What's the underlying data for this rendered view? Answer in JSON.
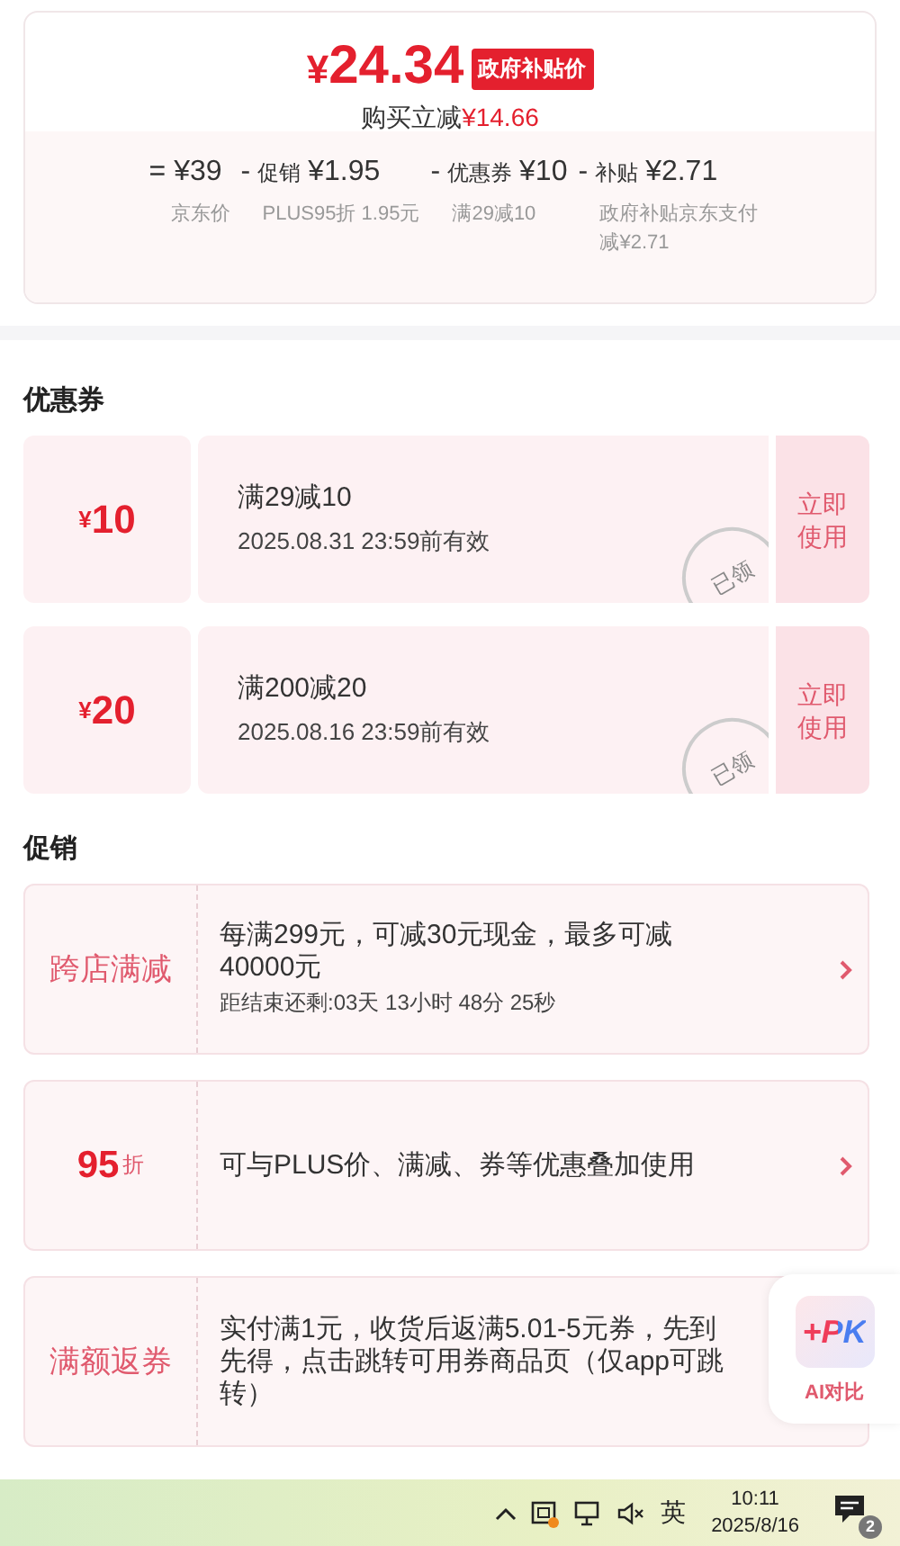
{
  "price": {
    "symbol": "¥",
    "amount": "24.34",
    "badge": "政府补贴价",
    "saving_label": "购买立减",
    "saving_amount": "¥14.66"
  },
  "breakdown": [
    {
      "operator": "=",
      "amount": "¥39",
      "note": "京东价"
    },
    {
      "operator": "-",
      "label": "促销",
      "amount": "¥1.95",
      "note": "PLUS95折 1.95元"
    },
    {
      "operator": "-",
      "label": "优惠券",
      "amount": "¥10",
      "note": "满29减10"
    },
    {
      "operator": "-",
      "label": "补贴",
      "amount": "¥2.71",
      "note": "政府补贴京东支付减¥2.71"
    }
  ],
  "coupons_title": "优惠券",
  "coupons": [
    {
      "symbol": "¥",
      "amount": "10",
      "condition": "满29减10",
      "validity": "2025.08.31 23:59前有效",
      "action": "立即使用",
      "stamp": "已领"
    },
    {
      "symbol": "¥",
      "amount": "20",
      "condition": "满200减20",
      "validity": "2025.08.16 23:59前有效",
      "action": "立即使用",
      "stamp": "已领"
    }
  ],
  "promotions_title": "促销",
  "promotions": [
    {
      "kind": "label",
      "tag": "跨店满减",
      "text": "每满299元，可减30元现金，最多可减40000元",
      "countdown": "距结束还剩:03天 13小时 48分 25秒",
      "chevron": true
    },
    {
      "kind": "discount",
      "tag_number": "95",
      "tag_unit": "折",
      "text": "可与PLUS价、满减、券等优惠叠加使用",
      "chevron": true
    },
    {
      "kind": "label",
      "tag": "满额返券",
      "text": "实付满1元，收货后返满5.01-5元券，先到先得，点击跳转可用券商品页（仅app可跳转）",
      "chevron": false
    }
  ],
  "floating": {
    "badge": "+PK",
    "label": "AI对比"
  },
  "taskbar": {
    "input_method": "英",
    "time": "10:11",
    "date": "2025/8/16",
    "notifications": "2"
  }
}
